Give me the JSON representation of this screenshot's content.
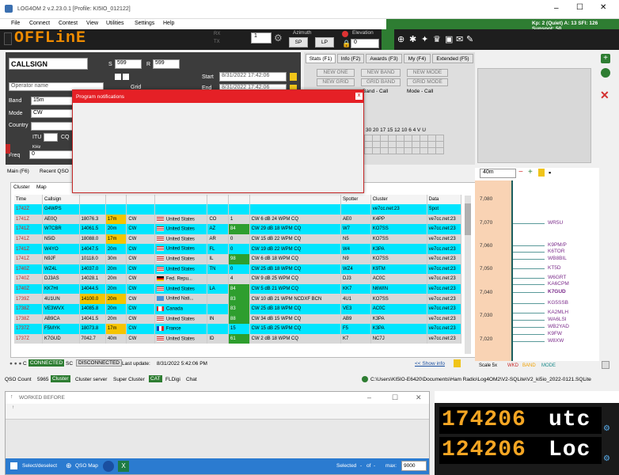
{
  "window": {
    "title": "LOG4OM 2 v.2.23.0.1 [Profile: KI5IO_012122]",
    "kp_line": "Kp: 2 (Quiet)  A: 13  SFI: 126 Sunspot: 50"
  },
  "menu": [
    "File",
    "Connect",
    "Contest",
    "View",
    "Utilities",
    "Settings",
    "Help"
  ],
  "toolbar": {
    "status": "OFFLinE",
    "rx": "RX",
    "tx": "TX",
    "spin": "1",
    "azimuth": "Azimuth",
    "sp": "SP",
    "lp": "LP",
    "elevation": "Elevation",
    "elevation_value": "0"
  },
  "qso": {
    "callsign": "CALLSIGN",
    "s_label": "S",
    "s_value": "599",
    "r_label": "R",
    "r_value": "599",
    "operator_placeholder": "Operator name",
    "grid_label": "Grid",
    "band_label": "Band",
    "band": "15m",
    "mode_label": "Mode",
    "mode": "CW",
    "country_label": "Country",
    "itu_label": "ITU",
    "cq_label": "CQ",
    "khz": "KHz",
    "freq_label": "Freq",
    "freq": "0",
    "start_label": "Start",
    "start": "8/31/2022 17:42:06",
    "end_label": "End",
    "end": "8/31/2022 17:42:06"
  },
  "tabs_right": [
    "Stats (F1)",
    "Info (F2)",
    "Awards (F3)",
    "My (F4)",
    "Extended (F5)"
  ],
  "stats": {
    "new_one": "NEW ONE",
    "new_band": "NEW BAND",
    "new_mode": "NEW MODE",
    "new_grid": "GRID BAND",
    "new_grid2": "NEW GRID",
    "grid_mode": "GRID MODE",
    "band_call": "Band - Call",
    "mode_call": "Mode - Call",
    "band_header": "30 20 17 15 12 10  6  4  V  U"
  },
  "dialog": {
    "title": "Program notifications",
    "close": "x"
  },
  "main_tabs": [
    "Main (F6)",
    "Recent QSO"
  ],
  "cluster_tabs": [
    "Cluster",
    "Map"
  ],
  "cluster_cols": [
    "Time",
    "Callsign",
    "",
    "",
    "",
    "",
    "",
    "",
    "",
    "Spotter",
    "Cluster",
    "Data"
  ],
  "cluster_rows": [
    [
      "1742Z",
      "G4WPS",
      "",
      "",
      "",
      "",
      "",
      "",
      "",
      "",
      "ve7cc.net:23",
      "Spot",
      "#00e5ff"
    ],
    [
      "1741Z",
      "AE0Q",
      "18076.3",
      "17m",
      "CW",
      "United States",
      "CO",
      "1",
      "CW 6 dB 24 WPM CQ",
      "AE0",
      "K4PP",
      "ve7cc.net:23",
      "#d8d8d8"
    ],
    [
      "1741Z",
      "W7CBR",
      "14061.5",
      "20m",
      "CW",
      "United States",
      "AZ",
      "84",
      "CW 29 dB 18 WPM CQ",
      "W7",
      "KO7SS",
      "ve7cc.net:23",
      "#00e5ff"
    ],
    [
      "1741Z",
      "N5ID",
      "18088.0",
      "17m",
      "CW",
      "United States",
      "AR",
      "0",
      "CW 15 dB 22 WPM CQ",
      "N5",
      "KO7SS",
      "ve7cc.net:23",
      "#d8d8d8"
    ],
    [
      "1741Z",
      "W4YO",
      "14047.5",
      "20m",
      "CW",
      "United States",
      "FL",
      "0",
      "CW 19 dB 22 WPM CQ",
      "W4",
      "K3PA",
      "ve7cc.net:23",
      "#00e5ff"
    ],
    [
      "1741Z",
      "N9JF",
      "10118.0",
      "30m",
      "CW",
      "United States",
      "IL",
      "98",
      "CW 6 dB 18 WPM CQ",
      "N9",
      "KO7SS",
      "ve7cc.net:23",
      "#d8d8d8"
    ],
    [
      "1740Z",
      "WZ4L",
      "14037.0",
      "20m",
      "CW",
      "United States",
      "TN",
      "0",
      "CW 25 dB 18 WPM CQ",
      "WZ4",
      "K9TM",
      "ve7cc.net:23",
      "#00e5ff"
    ],
    [
      "1740Z",
      "DJ3AS",
      "14028.1",
      "20m",
      "CW",
      "Fed. Repu...",
      "",
      "4",
      "CW 9 dB 25 WPM CQ",
      "DJ3",
      "AC0C",
      "ve7cc.net:23",
      "#d8d8d8"
    ],
    [
      "1740Z",
      "KK7HI",
      "14044.5",
      "20m",
      "CW",
      "United States",
      "LA",
      "84",
      "CW 5 dB 21 WPM CQ",
      "KK7",
      "N6WIN",
      "ve7cc.net:23",
      "#00e5ff"
    ],
    [
      "1739Z",
      "4U1UN",
      "14100.0",
      "20m",
      "CW",
      "United Nati...",
      "",
      "83",
      "CW 10 dB 21 WPM NCDXF BCN",
      "4U1",
      "KO7SS",
      "ve7cc.net:23",
      "#d8d8d8"
    ],
    [
      "1738Z",
      "VE3WVX",
      "14085.8",
      "20m",
      "CW",
      "Canada",
      "",
      "83",
      "CW 25 dB 18 WPM CQ",
      "VE3",
      "AC0C",
      "ve7cc.net:23",
      "#00e5ff"
    ],
    [
      "1738Z",
      "AB9CA",
      "14041.5",
      "20m",
      "CW",
      "United States",
      "IN",
      "88",
      "CW 34 dB 15 WPM CQ",
      "AB9",
      "K3PA",
      "ve7cc.net:23",
      "#d8d8d8"
    ],
    [
      "1737Z",
      "F5MYK",
      "18073.8",
      "17m",
      "CW",
      "France",
      "",
      "15",
      "CW 15 dB 25 WPM CQ",
      "F5",
      "K3PA",
      "ve7cc.net:23",
      "#00e5ff"
    ],
    [
      "1737Z",
      "K7GUD",
      "7042.7",
      "40m",
      "CW",
      "United States",
      "ID",
      "61",
      "CW 2 dB 18 WPM CQ",
      "K7",
      "NC7J",
      "ve7cc.net:23",
      "#d8d8d8"
    ]
  ],
  "cluster_status": {
    "cc": "C",
    "connected": "CONNECTED",
    "sc": "SC",
    "disconnected": "DISCONNECTED",
    "last_update_label": "Last update:",
    "last_update": "8/31/2022 5:42:06 PM",
    "show_info": "<< Show info"
  },
  "bandmap": {
    "band": "40m",
    "freqs": [
      "7,080",
      "7,070",
      "7,060",
      "7,050",
      "7,040",
      "7,030",
      "7,020"
    ],
    "calls": [
      "WR5U",
      "K9PM/P",
      "K6TOR",
      "WB8BIL",
      "KT5D",
      "W6GRT",
      "KA6CPM",
      "K7GUD",
      "KG5SSB",
      "KA2MLH",
      "WA6LSI",
      "WB2YAD",
      "K9FW",
      "W8XW"
    ],
    "scale": "Scale 5x",
    "wkd": "WKD",
    "band_l": "BAND",
    "mode_l": "MODE"
  },
  "statusbar": {
    "qso_count_label": "QSO Count",
    "qso_count": "5965",
    "cluster": "Cluster",
    "cluster_server": "Cluster server",
    "super_cluster": "Super Cluster",
    "cat": "CAT",
    "fldigi": "FLDigi",
    "chat": "Chat",
    "path": "C:\\Users\\KI5IO-E6420\\Documents\\Ham Radio\\Log4OM2\\V2-SQLite\\V2_ki5io_2022-0121.SQLite"
  },
  "worked": {
    "title": "WORKED BEFORE",
    "select": "Select/deselect",
    "qso_map": "QSO Map",
    "selected_label": "Selected",
    "of_label": "of",
    "max_label": "max:",
    "max": "9000"
  },
  "clock": {
    "utc_time": "174206",
    "utc_label": "utc",
    "loc_time": "124206",
    "loc_label": "Loc"
  }
}
